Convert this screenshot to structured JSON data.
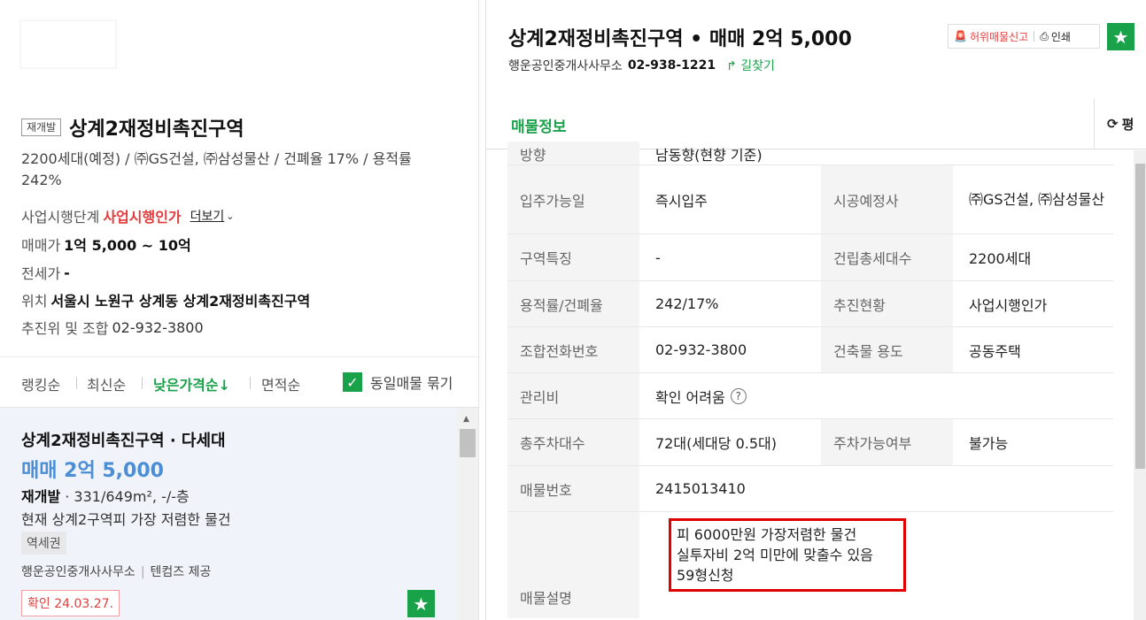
{
  "complex": {
    "badge": "재개발",
    "title": "상계2재정비촉진구역",
    "desc": "2200세대(예정) / ㈜GS건설, ㈜삼성물산 / 건폐율 17% / 용적률 242%",
    "stage_label": "사업시행단계",
    "stage_value": "사업시행인가",
    "more": "더보기",
    "sale_label": "매매가",
    "sale_value": "1억 5,000 ~ 10억",
    "jeonse_label": "전세가",
    "jeonse_value": "-",
    "location_label": "위치",
    "location_value": "서울시 노원구 상계동 상계2재정비촉진구역",
    "union_label": "추진위 및 조합",
    "union_phone": "02-932-3800"
  },
  "sort": {
    "items": [
      "랭킹순",
      "최신순",
      "낮은가격순↓",
      "면적순"
    ],
    "group_label": "동일매물 묶기"
  },
  "listing": {
    "title": "상계2재정비촉진구역 · 다세대",
    "price": "매매 2억 5,000",
    "spec_type": "재개발",
    "spec_rest": " · 331/649m², -/-층",
    "note": "현재 상계2구역피 가장 저렴한 물건",
    "tag": "역세권",
    "agent": "행운공인중개사사무소",
    "provider": "텐컴즈 제공",
    "confirm": "확인 24.03.27."
  },
  "detail": {
    "title": "상계2재정비촉진구역 • 매매 2억 5,000",
    "agent": "행운공인중개사사무소",
    "phone": "02-938-1221",
    "route": "길찾기",
    "report": "허위매물신고",
    "print": "인쇄",
    "tab": "매물정보",
    "tab_right": "평",
    "partial_row": "남동향(현향 기준)"
  },
  "table": {
    "move_in_label": "입주가능일",
    "move_in": "즉시입주",
    "builder_label": "시공예정사",
    "builder": "㈜GS건설, ㈜삼성물산",
    "zone_label": "구역특징",
    "zone": "-",
    "households_label": "건립총세대수",
    "households": "2200세대",
    "ratio_label": "용적률/건폐율",
    "ratio": "242/17%",
    "progress_label": "추진현황",
    "progress": "사업시행인가",
    "union_phone_label": "조합전화번호",
    "union_phone": "02-932-3800",
    "usage_label": "건축물 용도",
    "usage": "공동주택",
    "fee_label": "관리비",
    "fee": "확인 어려움",
    "parking_label": "총주차대수",
    "parking": "72대(세대당 0.5대)",
    "parking_ok_label": "주차가능여부",
    "parking_ok": "불가능",
    "listing_no_label": "매물번호",
    "listing_no": "2415013410",
    "description_label": "매물설명",
    "description": [
      "피 6000만원 가장저렴한 물건",
      "실투자비 2억 미만에 맞출수 있음",
      "59형신청"
    ]
  },
  "colors": {
    "accent": "#1aa24b",
    "price": "#4a8ed6",
    "alert": "#e23b3b"
  }
}
